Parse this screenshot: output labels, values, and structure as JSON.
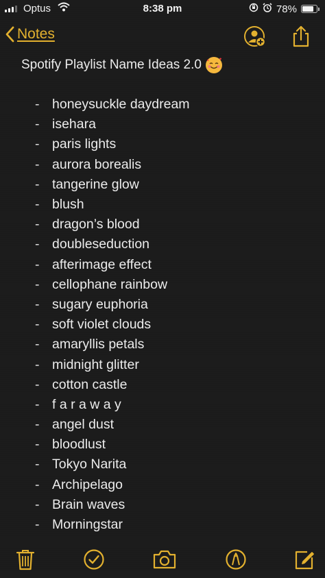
{
  "status_bar": {
    "carrier": "Optus",
    "time": "8:38 pm",
    "battery_percent": "78%",
    "battery_level": 0.78,
    "icons": [
      "signal-icon",
      "wifi-icon",
      "screen-rotation-lock-icon",
      "alarm-icon",
      "battery-icon"
    ]
  },
  "nav": {
    "back_label": "Notes",
    "back_icon": "chevron-left-icon",
    "share_people_icon": "add-person-icon",
    "share_icon": "share-icon"
  },
  "note": {
    "title": "Spotify Playlist Name Ideas 2.0",
    "title_emoji": "smiling-face-with-hearts",
    "bullet": "-",
    "items": [
      "honeysuckle daydream",
      "isehara",
      "paris lights",
      "aurora borealis",
      "tangerine glow",
      "blush",
      "dragon’s blood",
      "doubleseduction",
      "afterimage effect",
      "cellophane rainbow",
      "sugary euphoria",
      "soft violet clouds",
      "amaryllis petals",
      "midnight glitter",
      "cotton castle",
      "f a r a w a y",
      "angel dust",
      "bloodlust",
      "Tokyo Narita",
      "Archipelago",
      "Brain waves",
      "Morningstar"
    ]
  },
  "toolbar": {
    "icons": [
      "trash-icon",
      "checklist-icon",
      "camera-icon",
      "markup-icon",
      "compose-icon"
    ]
  },
  "colors": {
    "accent": "#e3b12f",
    "background": "#1b1b1b",
    "text": "#ececec"
  }
}
